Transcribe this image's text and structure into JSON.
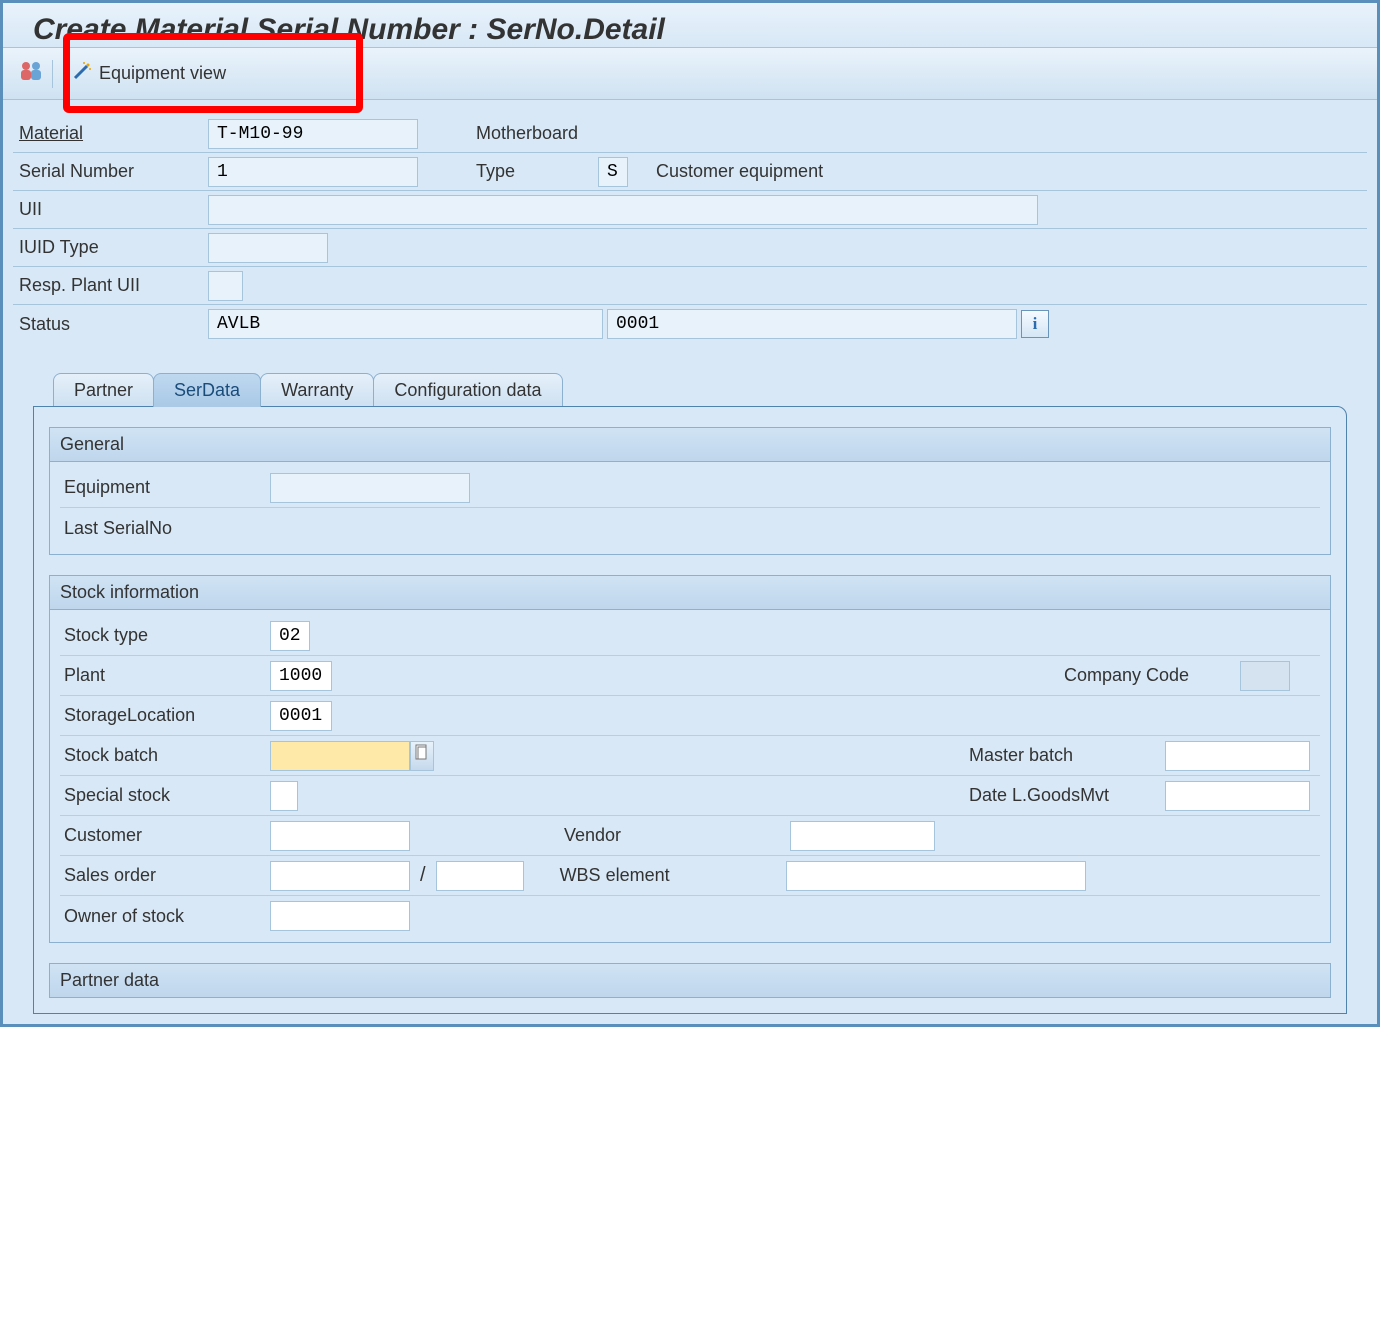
{
  "title": "Create Material Serial Number : SerNo.Detail",
  "toolbar": {
    "equipment_view": "Equipment view"
  },
  "header": {
    "material_label": "Material",
    "material_value": "T-M10-99",
    "material_desc": "Motherboard",
    "serial_label": "Serial Number",
    "serial_value": "1",
    "type_label": "Type",
    "type_value": "S",
    "type_desc": "Customer equipment",
    "uii_label": "UII",
    "uii_value": "",
    "iuid_type_label": "IUID Type",
    "iuid_type_value": "",
    "resp_plant_label": "Resp. Plant UII",
    "resp_plant_value": "",
    "status_label": "Status",
    "status_value": "AVLB",
    "status_code": "0001"
  },
  "tabs": {
    "partner": "Partner",
    "serdata": "SerData",
    "warranty": "Warranty",
    "config": "Configuration data"
  },
  "serdata": {
    "general": {
      "title": "General",
      "equipment_label": "Equipment",
      "equipment_value": "",
      "last_serial_label": "Last SerialNo"
    },
    "stock": {
      "title": "Stock information",
      "stock_type_label": "Stock type",
      "stock_type_value": "02",
      "plant_label": "Plant",
      "plant_value": "1000",
      "company_code_label": "Company Code",
      "company_code_value": "",
      "storage_loc_label": "StorageLocation",
      "storage_loc_value": "0001",
      "stock_batch_label": "Stock batch",
      "stock_batch_value": "",
      "master_batch_label": "Master batch",
      "master_batch_value": "",
      "special_stock_label": "Special stock",
      "special_stock_value": "",
      "date_goods_label": "Date L.GoodsMvt",
      "date_goods_value": "",
      "customer_label": "Customer",
      "customer_value": "",
      "vendor_label": "Vendor",
      "vendor_value": "",
      "sales_order_label": "Sales order",
      "sales_order_value": "",
      "sales_order_item": "",
      "wbs_label": "WBS element",
      "wbs_value": "",
      "owner_label": "Owner of stock",
      "owner_value": ""
    },
    "partner_data": {
      "title": "Partner data"
    }
  }
}
